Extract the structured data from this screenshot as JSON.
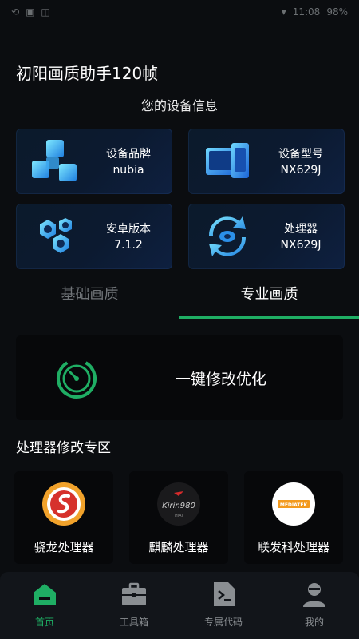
{
  "status_bar": {
    "left_icons": [
      "sync-icon",
      "image-icon",
      "app-icon"
    ],
    "clock": "11:08",
    "battery": "98%"
  },
  "app": {
    "title": "初阳画质助手120帧"
  },
  "device_info": {
    "heading": "您的设备信息",
    "cards": [
      {
        "label": "设备品牌",
        "value": "nubia",
        "icon": "cubes-icon"
      },
      {
        "label": "设备型号",
        "value": "NX629J",
        "icon": "devices-icon"
      },
      {
        "label": "安卓版本",
        "value": "7.1.2",
        "icon": "nuts-icon"
      },
      {
        "label": "处理器",
        "value": "NX629J",
        "icon": "refresh-chip-icon"
      }
    ]
  },
  "tabs": {
    "basic": "基础画质",
    "pro": "专业画质",
    "active": "pro"
  },
  "optimize": {
    "label": "一键修改优化",
    "icon": "power-timer-icon"
  },
  "processor_zone": {
    "title": "处理器修改专区",
    "items": [
      {
        "label": "骁龙处理器",
        "icon": "snapdragon-logo"
      },
      {
        "label": "麒麟处理器",
        "icon": "kirin-logo"
      },
      {
        "label": "联发科处理器",
        "icon": "mediatek-logo"
      }
    ]
  },
  "bottom_nav": {
    "items": [
      {
        "label": "首页",
        "icon": "home-icon",
        "active": true
      },
      {
        "label": "工具箱",
        "icon": "toolbox-icon",
        "active": false
      },
      {
        "label": "专属代码",
        "icon": "code-file-icon",
        "active": false
      },
      {
        "label": "我的",
        "icon": "user-icon",
        "active": false
      }
    ]
  },
  "colors": {
    "accent": "#1fae64",
    "card_bg": "#0c1a30",
    "background": "#0b0d10"
  }
}
